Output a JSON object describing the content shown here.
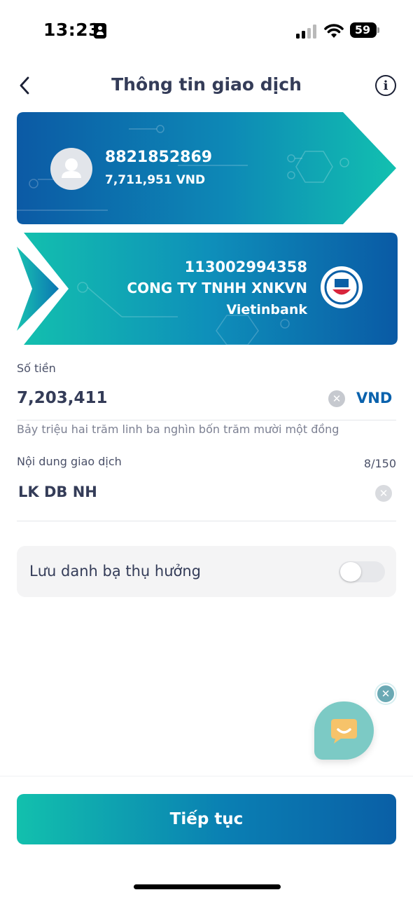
{
  "status_bar": {
    "time": "13:23",
    "battery": "59"
  },
  "header": {
    "title": "Thông tin giao dịch"
  },
  "source": {
    "account_number": "8821852869",
    "balance": "7,711,951 VND"
  },
  "destination": {
    "account_number": "113002994358",
    "name": "CONG TY TNHH XNKVN",
    "bank": "Vietinbank"
  },
  "amount": {
    "label": "Số tiền",
    "value": "7,203,411",
    "currency": "VND",
    "in_words": "Bảy triệu hai trăm linh ba nghìn bốn trăm mười một đồng"
  },
  "content": {
    "label": "Nội dung giao dịch",
    "counter": "8/150",
    "value": "LK DB NH"
  },
  "save_contact": {
    "label": "Lưu danh bạ thụ hưởng",
    "enabled": false
  },
  "footer": {
    "continue_label": "Tiếp tục"
  },
  "icons": {
    "back": "chevron-left-icon",
    "info": "info-icon",
    "clear": "clear-icon",
    "chat": "chat-icon",
    "avatar": "user-icon",
    "bank_logo": "vietinbank-logo"
  },
  "colors": {
    "primary_blue": "#0a5fa6",
    "teal": "#12c0ad",
    "text": "#343c58",
    "chat": "#7ccac5"
  }
}
